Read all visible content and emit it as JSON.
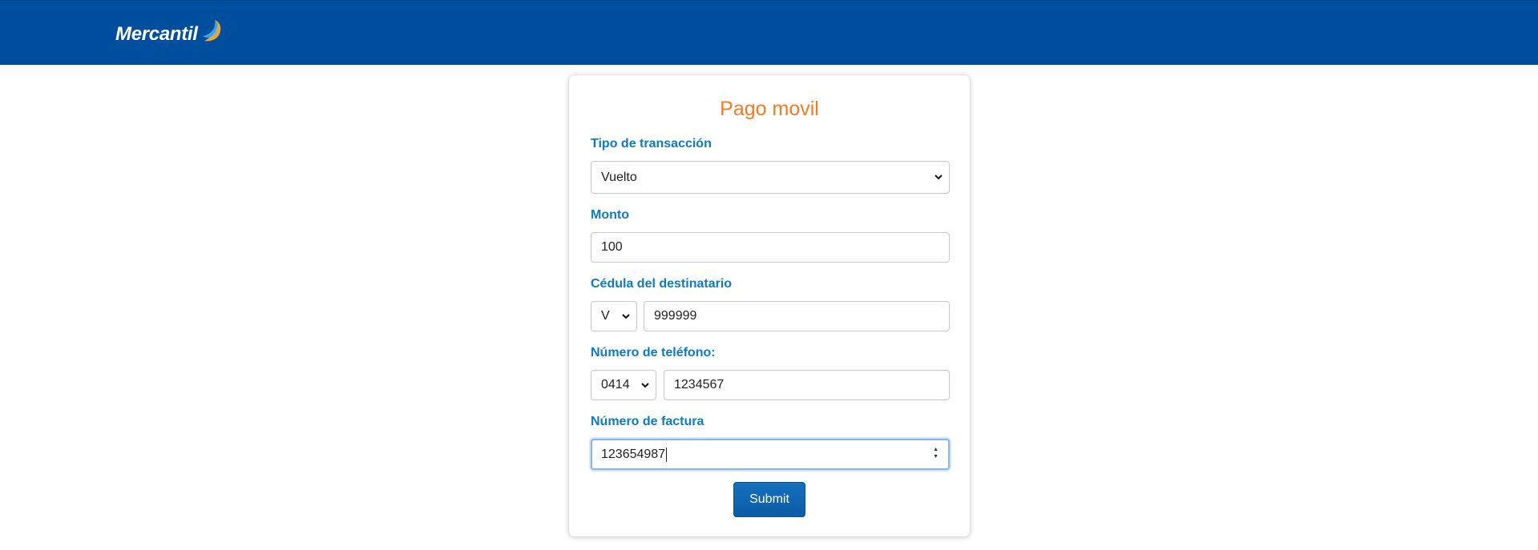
{
  "header": {
    "logo_text": "Mercantil",
    "colors": {
      "bar": "#004f9f",
      "swoosh_orange": "#f7a21b",
      "swoosh_blue": "#3aa0e6"
    }
  },
  "form": {
    "title": "Pago movil",
    "transaction_type": {
      "label": "Tipo de transacción",
      "value": "Vuelto"
    },
    "amount": {
      "label": "Monto",
      "value": "100"
    },
    "id_number": {
      "label": "Cédula del destinatario",
      "prefix": "V",
      "value": "999999"
    },
    "phone": {
      "label": "Número de teléfono:",
      "prefix": "0414",
      "value": "1234567"
    },
    "invoice": {
      "label": "Número de factura",
      "value": "123654987"
    },
    "submit_label": "Submit",
    "colors": {
      "title": "#f47b20",
      "label": "#0d7bc0",
      "button": "#0a5ca4"
    }
  }
}
